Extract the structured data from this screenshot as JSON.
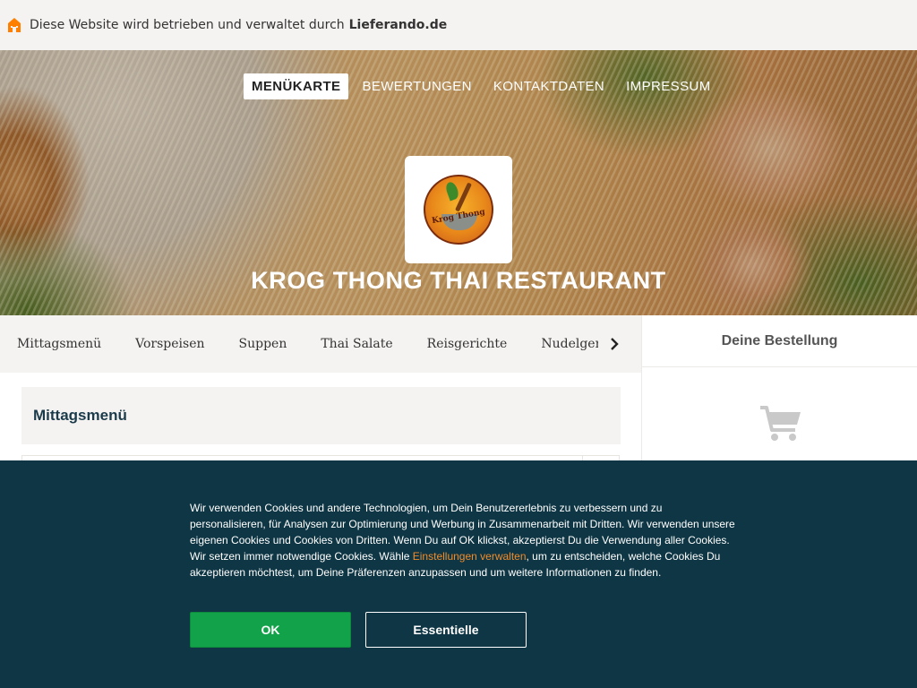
{
  "topbar": {
    "icon": "home-icon",
    "text": "Diese Website wird betrieben und verwaltet durch",
    "brand": "Lieferando.de",
    "accent": "#ff8000"
  },
  "nav": {
    "items": [
      {
        "label": "MENÜKARTE",
        "active": true
      },
      {
        "label": "BEWERTUNGEN",
        "active": false
      },
      {
        "label": "KONTAKTDATEN",
        "active": false
      },
      {
        "label": "IMPRESSUM",
        "active": false
      }
    ]
  },
  "restaurant": {
    "name": "KROG THONG THAI RESTAURANT",
    "logo_text": "Krog Thong"
  },
  "categories": {
    "items": [
      "Mittagsmenü",
      "Vorspeisen",
      "Suppen",
      "Thai Salate",
      "Reisgerichte",
      "Nudelgericht"
    ],
    "next_icon": "chevron-right-icon"
  },
  "menu": {
    "section_title": "Mittagsmenü"
  },
  "basket": {
    "title": "Deine Bestellung",
    "icon": "cart-icon"
  },
  "cookie": {
    "text_before_link": "Wir verwenden Cookies und andere Technologien, um Dein Benutzererlebnis zu verbessern und zu personalisieren, für Analysen zur Optimierung und Werbung in Zusammenarbeit mit Dritten. Wir verwenden unsere eigenen Cookies und Cookies von Dritten. Wenn Du auf OK klickst, akzeptierst Du die Verwendung aller Cookies. Wir setzen immer notwendige Cookies. Wähle ",
    "link_text": "Einstellungen verwalten",
    "text_after_link": ", um zu entscheiden, welche Cookies Du akzeptieren möchtest, um Deine Präferenzen anzupassen und um weitere Informationen zu finden.",
    "ok_label": "OK",
    "essential_label": "Essentielle",
    "ok_color": "#12a34a",
    "background": "#0f3644",
    "link_color": "#f08c2c"
  }
}
